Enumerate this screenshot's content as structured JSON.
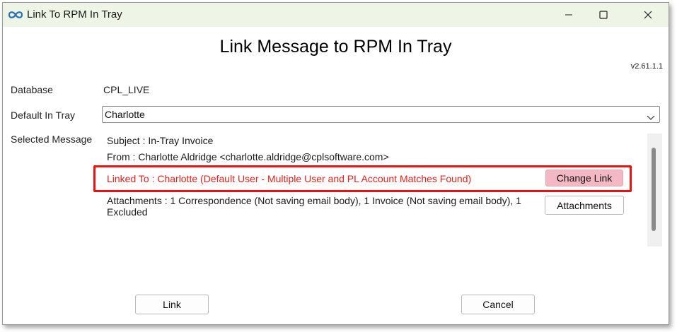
{
  "window": {
    "title": "Link To RPM In Tray",
    "minimize_icon": "minimize-icon",
    "maximize_icon": "maximize-icon",
    "close_icon": "close-icon",
    "app_icon": "infinity-icon"
  },
  "heading": "Link Message to RPM In Tray",
  "version": "v2.61.1.1",
  "fields": {
    "database_label": "Database",
    "database_value": "CPL_LIVE",
    "default_in_tray_label": "Default In Tray",
    "default_in_tray_value": "Charlotte",
    "selected_message_label": "Selected Message"
  },
  "message": {
    "subject": "Subject : In-Tray Invoice",
    "from": "From : Charlotte Aldridge <charlotte.aldridge@cplsoftware.com>",
    "linked_to": "Linked To : Charlotte (Default User - Multiple User and PL Account Matches Found)",
    "attachments_line1": "Attachments : 1 Correspondence (Not saving email body), 1 Invoice (Not saving email body), 1",
    "attachments_line2": "Excluded"
  },
  "buttons": {
    "change_link": "Change Link",
    "attachments": "Attachments",
    "link": "Link",
    "cancel": "Cancel"
  },
  "colors": {
    "titlebar": "#eef4e6",
    "linked_text": "#e0221b",
    "highlight_border": "#ee1111",
    "change_link_bg": "#f4b8c3"
  }
}
